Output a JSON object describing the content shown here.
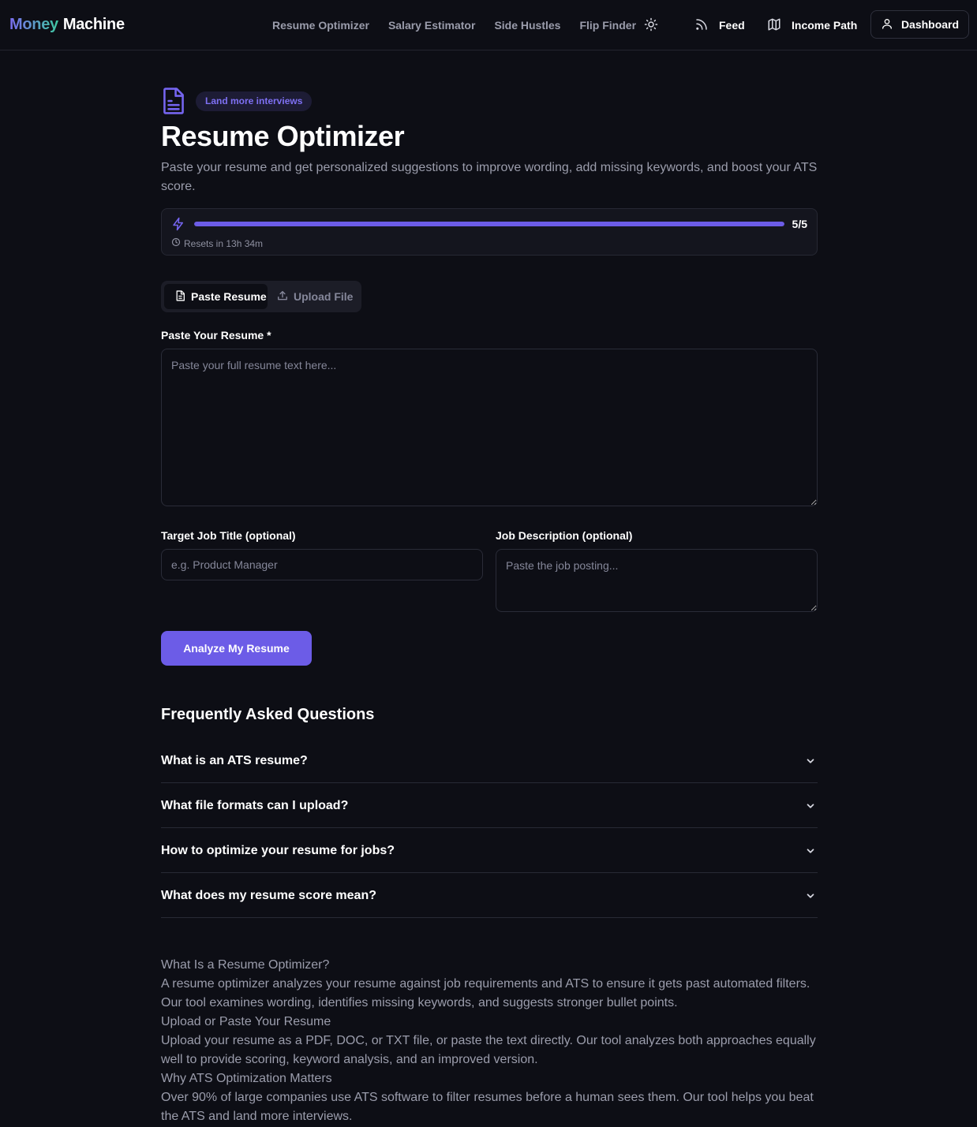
{
  "header": {
    "logo_part1": "Money",
    "logo_part2": "Machine",
    "nav": [
      {
        "label": "Resume Optimizer"
      },
      {
        "label": "Salary Estimator"
      },
      {
        "label": "Side Hustles"
      },
      {
        "label": "Flip Finder"
      }
    ],
    "theme_icon": "sun-icon",
    "feed_label": "Feed",
    "income_path_label": "Income Path",
    "dashboard_label": "Dashboard"
  },
  "hero": {
    "icon": "document-icon",
    "badge": "Land more interviews",
    "title": "Resume Optimizer",
    "subtitle": "Paste your resume and get personalized suggestions to improve wording, add missing keywords, and boost your ATS score."
  },
  "usage": {
    "count": "5/5",
    "progress_fraction": 1.0,
    "reset_text": "Resets in 13h 34m"
  },
  "tabs": {
    "paste": "Paste Resume",
    "upload": "Upload File"
  },
  "form": {
    "resume_label": "Paste Your Resume *",
    "resume_placeholder": "Paste your full resume text here...",
    "job_title_label": "Target Job Title (optional)",
    "job_title_placeholder": "e.g. Product Manager",
    "job_desc_label": "Job Description (optional)",
    "job_desc_placeholder": "Paste the job posting...",
    "submit_label": "Analyze My Resume"
  },
  "faq": {
    "title": "Frequently Asked Questions",
    "items": [
      {
        "q": "What is an ATS resume?"
      },
      {
        "q": "What file formats can I upload?"
      },
      {
        "q": "How to optimize your resume for jobs?"
      },
      {
        "q": "What does my resume score mean?"
      }
    ]
  },
  "info": {
    "sections": [
      {
        "heading": "What Is a Resume Optimizer?",
        "body": "A resume optimizer analyzes your resume against job requirements and ATS to ensure it gets past automated filters. Our tool examines wording, identifies missing keywords, and suggests stronger bullet points."
      },
      {
        "heading": "Upload or Paste Your Resume",
        "body": "Upload your resume as a PDF, DOC, or TXT file, or paste the text directly. Our tool analyzes both approaches equally well to provide scoring, keyword analysis, and an improved version."
      },
      {
        "heading": "Why ATS Optimization Matters",
        "body": "Over 90% of large companies use ATS software to filter resumes before a human sees them. Our tool helps you beat the ATS and land more interviews."
      }
    ]
  },
  "colors": {
    "accent": "#6c5ce7",
    "background": "#0d0e15"
  }
}
